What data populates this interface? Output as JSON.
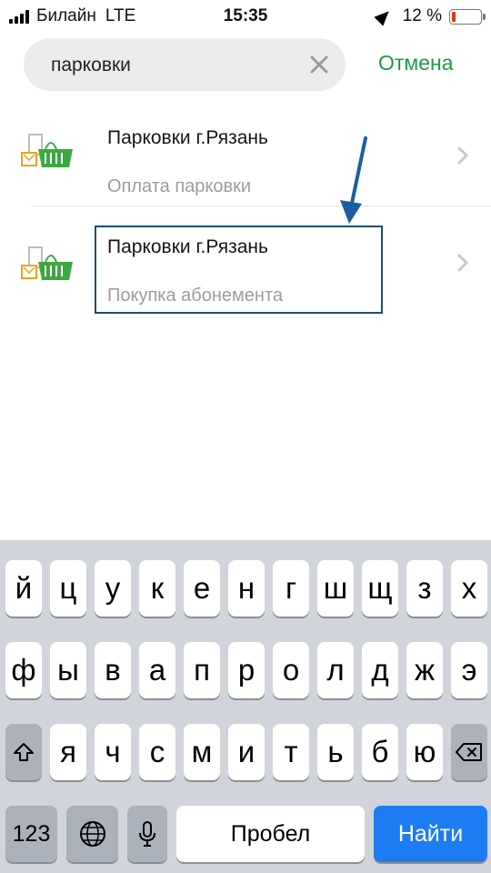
{
  "status_bar": {
    "carrier": "Билайн",
    "network": "LTE",
    "time": "15:35",
    "battery_percent": "12 %",
    "battery_level": 0.12
  },
  "search": {
    "value": "парковки",
    "cancel_label": "Отмена"
  },
  "results": [
    {
      "title": "Парковки г.Рязань",
      "subtitle": "Оплата парковки",
      "icon": "parking-cart-icon"
    },
    {
      "title": "Парковки г.Рязань",
      "subtitle": "Покупка абонемента",
      "icon": "parking-cart-icon"
    }
  ],
  "keyboard": {
    "row1": [
      "й",
      "ц",
      "у",
      "к",
      "е",
      "н",
      "г",
      "ш",
      "щ",
      "з",
      "х"
    ],
    "row2": [
      "ф",
      "ы",
      "в",
      "а",
      "п",
      "р",
      "о",
      "л",
      "д",
      "ж",
      "э"
    ],
    "row3": [
      "я",
      "ч",
      "с",
      "м",
      "и",
      "т",
      "ь",
      "б",
      "ю"
    ],
    "numbers_label": "123",
    "space_label": "Пробел",
    "go_label": "Найти"
  },
  "colors": {
    "accent_green": "#1f9a45",
    "go_blue": "#1e7cf2",
    "highlight": "#1b4f72"
  }
}
